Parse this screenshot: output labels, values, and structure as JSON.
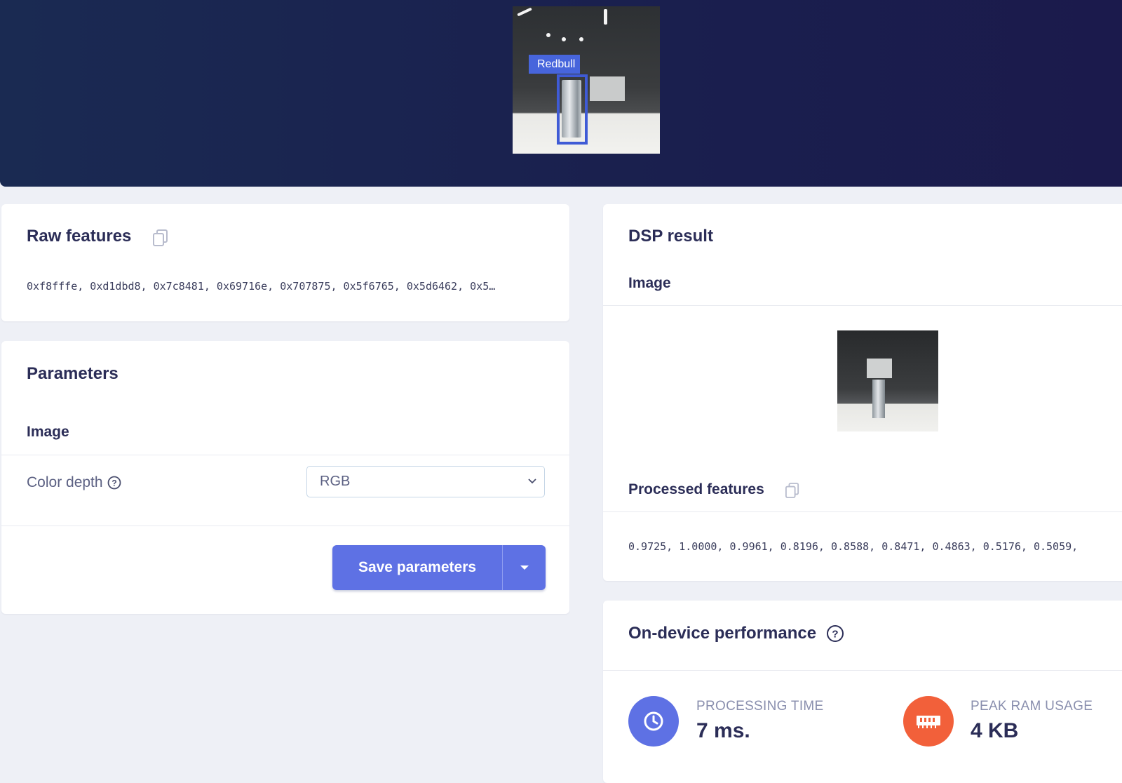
{
  "hero": {
    "detection_label": "Redbull"
  },
  "raw_features": {
    "title": "Raw features",
    "values": "0xf8fffe, 0xd1dbd8, 0x7c8481, 0x69716e, 0x707875, 0x5f6765, 0x5d6462, 0x5…",
    "copy_icon": "copy-icon"
  },
  "parameters": {
    "title": "Parameters",
    "section": "Image",
    "color_depth_label": "Color depth",
    "color_depth_value": "RGB",
    "save_label": "Save parameters"
  },
  "dsp_result": {
    "title": "DSP result",
    "image_section": "Image",
    "processed_title": "Processed features",
    "processed_values": "0.9725, 1.0000, 0.9961, 0.8196, 0.8588, 0.8471, 0.4863, 0.5176, 0.5059,"
  },
  "performance": {
    "title": "On-device performance",
    "processing_label": "PROCESSING TIME",
    "processing_value": "7 ms.",
    "ram_label": "PEAK RAM USAGE",
    "ram_value": "4 KB",
    "colors": {
      "processing": "#5e71e4",
      "ram": "#f2603a"
    }
  }
}
